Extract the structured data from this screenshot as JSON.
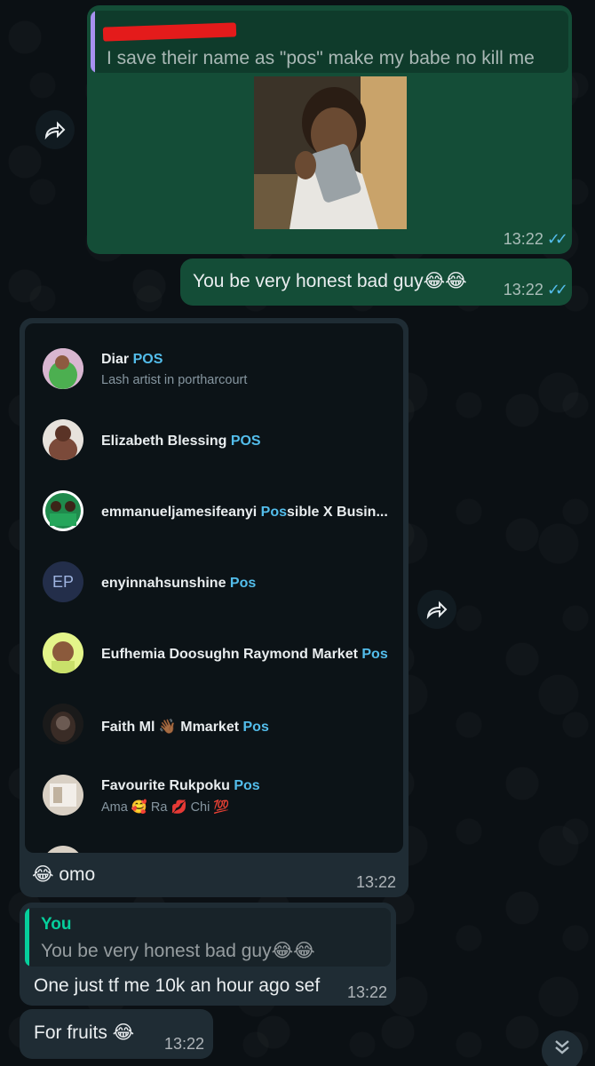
{
  "message1": {
    "quote_text": "I save their name as \"pos\" make my babe no kill me",
    "time": "13:22",
    "ticks": "✓✓"
  },
  "message2": {
    "text": "You be very honest bad guy😂😂",
    "time": "13:22",
    "ticks": "✓✓"
  },
  "contacts": [
    {
      "name": "Diar ",
      "highlight": "POS",
      "sub": "Lash artist in portharcourt"
    },
    {
      "name": "Elizabeth Blessing ",
      "highlight": "POS",
      "sub": ""
    },
    {
      "name": "emmanueljamesifeanyi ",
      "highlight": "Pos",
      "rest": "sible X Busin...",
      "sub": ""
    },
    {
      "name": "enyinnahsunshine ",
      "highlight": "Pos",
      "initials": "EP",
      "sub": ""
    },
    {
      "name": "Eufhemia Doosughn Raymond Market ",
      "highlight": "Pos",
      "sub": ""
    },
    {
      "name": "Faith Ml 👋🏾 Mmarket ",
      "highlight": "Pos",
      "sub": ""
    },
    {
      "name": "Favourite Rukpoku ",
      "highlight": "Pos",
      "sub": "Ama 🥰 Ra 💋 Chi 💯"
    }
  ],
  "message3": {
    "caption": "😂 omo",
    "time": "13:22"
  },
  "message4": {
    "quote_author": "You",
    "quote_text": "You be very honest bad guy😂😂",
    "text": "One just tf me 10k an hour ago sef",
    "time": "13:22"
  },
  "message5": {
    "text": "For fruits 😂",
    "time": "13:22"
  },
  "icons": {
    "forward": "forward-icon",
    "scroll_down": "double-chevron-down-icon"
  },
  "colors": {
    "outgoing": "#144d37",
    "incoming": "#1f2c34",
    "link": "#53bdeb",
    "background": "#0b1014"
  }
}
